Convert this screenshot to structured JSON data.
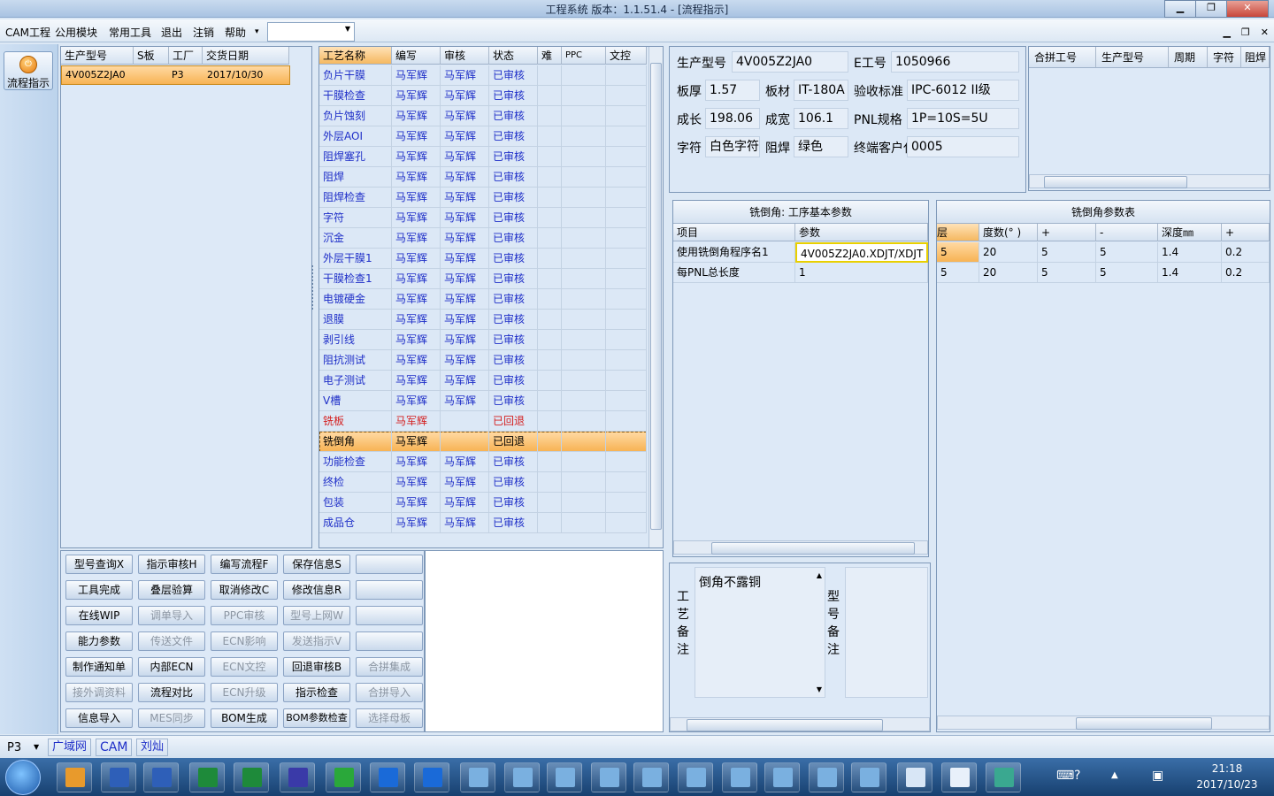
{
  "window": {
    "title": "工程系统   版本：1.1.51.4 - [流程指示]",
    "min": "▁",
    "max": "❐",
    "close": "✕"
  },
  "menu": {
    "items": [
      "CAM工程",
      "公用模块",
      "常用工具",
      "退出",
      "注销",
      "帮助"
    ],
    "help_arrow": "▾",
    "combo_value": ""
  },
  "mdi": {
    "min": "▁",
    "restore": "❐",
    "close": "✕"
  },
  "sidebar": {
    "flow_label": "流程指示"
  },
  "orders": {
    "headers": [
      "生产型号",
      "S板",
      "工厂",
      "交货日期"
    ],
    "rows": [
      [
        "4V005Z2JA0",
        "",
        "P3",
        "2017/10/30"
      ]
    ]
  },
  "process": {
    "headers": [
      "工艺名称",
      "编写",
      "审核",
      "状态",
      "难",
      "PPC",
      "文控"
    ],
    "rows": [
      {
        "name": "负片干膜",
        "writer": "马军辉",
        "reviewer": "马军辉",
        "status": "已审核"
      },
      {
        "name": "干膜检查",
        "writer": "马军辉",
        "reviewer": "马军辉",
        "status": "已审核"
      },
      {
        "name": "负片蚀刻",
        "writer": "马军辉",
        "reviewer": "马军辉",
        "status": "已审核"
      },
      {
        "name": "外层AOI",
        "writer": "马军辉",
        "reviewer": "马军辉",
        "status": "已审核"
      },
      {
        "name": "阻焊塞孔",
        "writer": "马军辉",
        "reviewer": "马军辉",
        "status": "已审核"
      },
      {
        "name": "阻焊",
        "writer": "马军辉",
        "reviewer": "马军辉",
        "status": "已审核"
      },
      {
        "name": "阻焊检查",
        "writer": "马军辉",
        "reviewer": "马军辉",
        "status": "已审核"
      },
      {
        "name": "字符",
        "writer": "马军辉",
        "reviewer": "马军辉",
        "status": "已审核"
      },
      {
        "name": "沉金",
        "writer": "马军辉",
        "reviewer": "马军辉",
        "status": "已审核"
      },
      {
        "name": "外层干膜1",
        "writer": "马军辉",
        "reviewer": "马军辉",
        "status": "已审核"
      },
      {
        "name": "干膜检查1",
        "writer": "马军辉",
        "reviewer": "马军辉",
        "status": "已审核"
      },
      {
        "name": "电镀硬金",
        "writer": "马军辉",
        "reviewer": "马军辉",
        "status": "已审核"
      },
      {
        "name": "退膜",
        "writer": "马军辉",
        "reviewer": "马军辉",
        "status": "已审核"
      },
      {
        "name": "剥引线",
        "writer": "马军辉",
        "reviewer": "马军辉",
        "status": "已审核"
      },
      {
        "name": "阻抗测试",
        "writer": "马军辉",
        "reviewer": "马军辉",
        "status": "已审核"
      },
      {
        "name": "电子测试",
        "writer": "马军辉",
        "reviewer": "马军辉",
        "status": "已审核"
      },
      {
        "name": "V槽",
        "writer": "马军辉",
        "reviewer": "马军辉",
        "status": "已审核"
      },
      {
        "name": "铣板",
        "writer": "马军辉",
        "reviewer": "",
        "status": "已回退"
      },
      {
        "name": "铣倒角",
        "writer": "马军辉",
        "reviewer": "",
        "status": "已回退"
      },
      {
        "name": "功能检查",
        "writer": "马军辉",
        "reviewer": "马军辉",
        "status": "已审核"
      },
      {
        "name": "终检",
        "writer": "马军辉",
        "reviewer": "马军辉",
        "status": "已审核"
      },
      {
        "name": "包装",
        "writer": "马军辉",
        "reviewer": "马军辉",
        "status": "已审核"
      },
      {
        "name": "成品仓",
        "writer": "马军辉",
        "reviewer": "马军辉",
        "status": "已审核"
      }
    ]
  },
  "buttons": [
    [
      "型号查询X",
      "指示审核H",
      "编写流程F",
      "保存信息S",
      ""
    ],
    [
      "工具完成",
      "叠层验算",
      "取消修改C",
      "修改信息R",
      ""
    ],
    [
      "在线WIP",
      "调单导入",
      "PPC审核",
      "型号上网W",
      ""
    ],
    [
      "能力参数",
      "传送文件",
      "ECN影响",
      "发送指示V",
      ""
    ],
    [
      "制作通知单",
      "内部ECN",
      "ECN文控",
      "回退审核B",
      "合拼集成"
    ],
    [
      "接外调资料",
      "流程对比",
      "ECN升级",
      "指示检查",
      "合拼导入"
    ],
    [
      "信息导入",
      "MES同步",
      "BOM生成",
      "BOM参数检查",
      "选择母板"
    ]
  ],
  "buttons_disabled": [
    [
      false,
      false,
      false,
      false,
      false
    ],
    [
      false,
      false,
      false,
      false,
      false
    ],
    [
      false,
      true,
      true,
      true,
      false
    ],
    [
      false,
      true,
      true,
      true,
      false
    ],
    [
      false,
      false,
      true,
      false,
      true
    ],
    [
      true,
      false,
      true,
      false,
      true
    ],
    [
      false,
      true,
      false,
      false,
      true
    ]
  ],
  "info": {
    "model_label": "生产型号",
    "model": "4V005Z2JA0",
    "eno_label": "E工号",
    "eno": "1050966",
    "thick_label": "板厚",
    "thick": "1.57",
    "mat_label": "板材",
    "mat": "IT-180A",
    "std_label": "验收标准",
    "std": "IPC-6012 II级",
    "len_label": "成长",
    "len": "198.06",
    "wid_label": "成宽",
    "wid": "106.1",
    "pnl_label": "PNL规格",
    "pnl": "1P=10S=5U",
    "char_label": "字符",
    "char": "白色字符",
    "mask_label": "阻焊",
    "mask": "绿色",
    "cust_label": "终端客户代码",
    "cust": "0005"
  },
  "merge": {
    "headers": [
      "合拼工号",
      "生产型号",
      "周期",
      "字符",
      "阻焊"
    ]
  },
  "params": {
    "title": "铣倒角: 工序基本参数",
    "headers": [
      "项目",
      "参数"
    ],
    "rows": [
      [
        "使用铣倒角程序名1",
        "4V005Z2JA0.XDJT/XDJT"
      ],
      [
        "每PNL总长度",
        "1"
      ]
    ]
  },
  "angle": {
    "title": "铣倒角参数表",
    "headers": [
      "层",
      "度数(° )",
      "+",
      "-",
      "深度㎜",
      "+"
    ],
    "rows": [
      [
        "5",
        "20",
        "5",
        "5",
        "1.4",
        "0.2"
      ],
      [
        "5",
        "20",
        "5",
        "5",
        "1.4",
        "0.2"
      ]
    ]
  },
  "notes": {
    "process_label": "工艺备注",
    "process_text": "倒角不露铜",
    "model_label": "型号备注",
    "model_text": ""
  },
  "status": {
    "factory": "P3",
    "net": "广域网",
    "dept": "CAM",
    "user": "刘灿"
  },
  "tray": {
    "time": "21:18",
    "date": "2017/10/23"
  }
}
